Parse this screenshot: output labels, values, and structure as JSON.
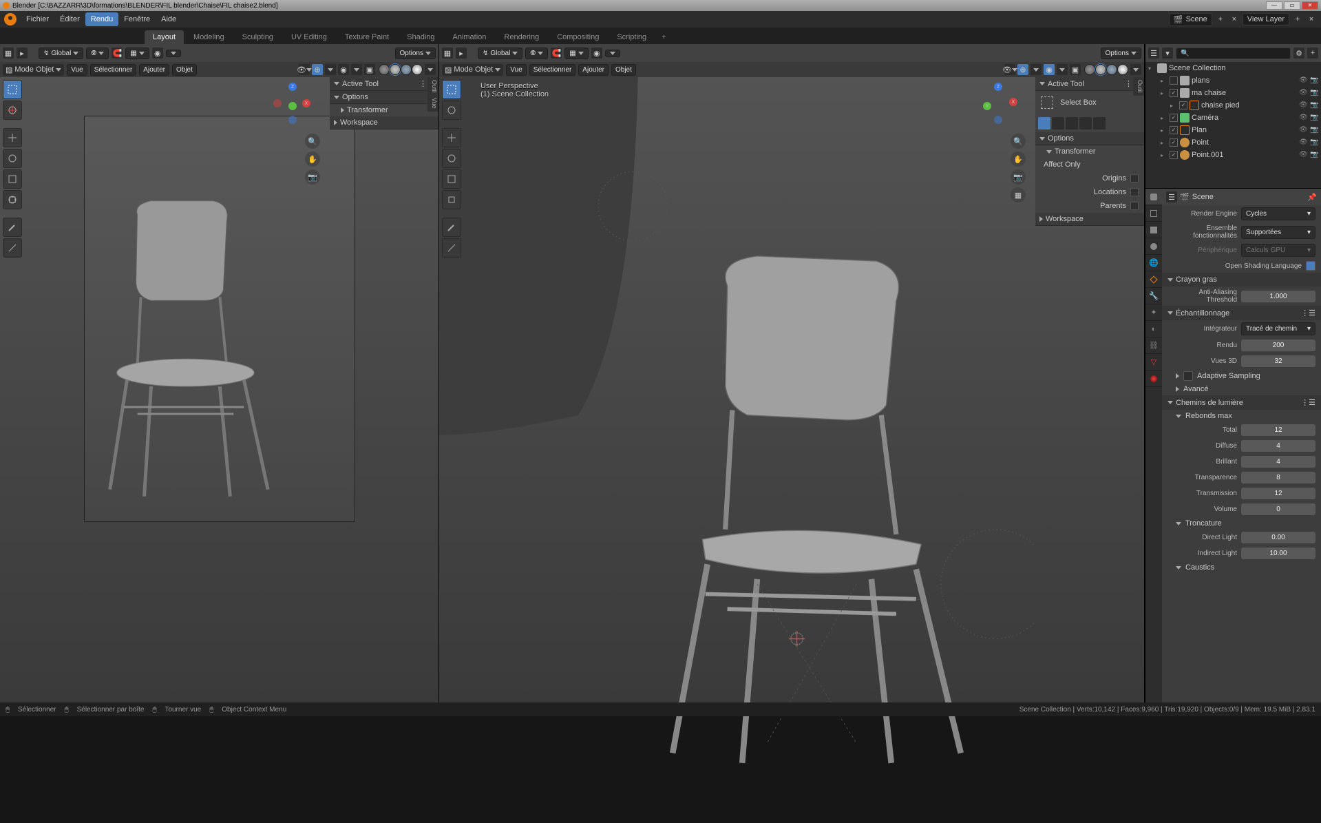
{
  "title": "Blender [C:\\BAZZARR\\3D\\formations\\BLENDER\\FIL blender\\Chaise\\FIL chaise2.blend]",
  "menubar": [
    "Fichier",
    "Éditer",
    "Rendu",
    "Fenêtre",
    "Aide"
  ],
  "workspaces": [
    "Layout",
    "Modeling",
    "Sculpting",
    "UV Editing",
    "Texture Paint",
    "Shading",
    "Animation",
    "Rendering",
    "Compositing",
    "Scripting"
  ],
  "scene_field": "Scene",
  "viewlayer_field": "View Layer",
  "viewport": {
    "mode": "Mode Objet",
    "orient": "Global",
    "options": "Options",
    "hdr2_menus": [
      "Vue",
      "Sélectionner",
      "Ajouter",
      "Objet"
    ],
    "overlay_l1": "User Perspective",
    "overlay_l2": "(1) Scene Collection"
  },
  "npanel": {
    "active_tool": "Active Tool",
    "options": "Options",
    "transformer": "Transformer",
    "workspace": "Workspace",
    "select_box": "Select Box",
    "affect_only": "Affect Only",
    "origins": "Origins",
    "locations": "Locations",
    "parents": "Parents"
  },
  "outliner": {
    "scene_collection": "Scene Collection",
    "items": [
      {
        "name": "plans",
        "type": "coll",
        "indent": 1,
        "checked": false
      },
      {
        "name": "ma chaise",
        "type": "coll",
        "indent": 1,
        "checked": true
      },
      {
        "name": "chaise pied",
        "type": "mesh",
        "indent": 2,
        "checked": true
      },
      {
        "name": "Caméra",
        "type": "cam",
        "indent": 1,
        "checked": true
      },
      {
        "name": "Plan",
        "type": "mesh",
        "indent": 1,
        "checked": true
      },
      {
        "name": "Point",
        "type": "light",
        "indent": 1,
        "checked": true
      },
      {
        "name": "Point.001",
        "type": "light",
        "indent": 1,
        "checked": true
      }
    ]
  },
  "props": {
    "breadcrumb": "Scene",
    "render_engine_lbl": "Render Engine",
    "render_engine_val": "Cycles",
    "feature_set_lbl": "Ensemble fonctionnalités",
    "feature_set_val": "Supportées",
    "device_lbl": "Périphérique",
    "device_val": "Calculs GPU",
    "osl_lbl": "Open Shading Language",
    "grease_hdr": "Crayon gras",
    "aa_thresh_lbl": "Anti-Aliasing Threshold",
    "aa_thresh_val": "1.000",
    "sampling_hdr": "Échantillonnage",
    "integrator_lbl": "Intégrateur",
    "integrator_val": "Tracé de chemin",
    "render_lbl": "Rendu",
    "render_val": "200",
    "viewport_lbl": "Vues 3D",
    "viewport_val": "32",
    "adaptive_lbl": "Adaptive Sampling",
    "advanced_lbl": "Avancé",
    "light_paths_hdr": "Chemins de lumière",
    "max_bounces_hdr": "Rebonds max",
    "total_lbl": "Total",
    "total_val": "12",
    "diffuse_lbl": "Diffuse",
    "diffuse_val": "4",
    "glossy_lbl": "Brillant",
    "glossy_val": "4",
    "transparency_lbl": "Transparence",
    "transparency_val": "8",
    "transmission_lbl": "Transmission",
    "transmission_val": "12",
    "volume_lbl": "Volume",
    "volume_val": "0",
    "clamping_hdr": "Troncature",
    "direct_lbl": "Direct Light",
    "direct_val": "0.00",
    "indirect_lbl": "Indirect Light",
    "indirect_val": "10.00",
    "caustics_hdr": "Caustics"
  },
  "status": {
    "select": "Sélectionner",
    "select_box": "Sélectionner par boîte",
    "rotate": "Tourner vue",
    "ctx_menu": "Object Context Menu",
    "stats": "Scene Collection | Verts:10,142 | Faces:9,960 | Tris:19,920 | Objects:0/9 | Mem: 19.5 MiB | 2.83.1"
  }
}
